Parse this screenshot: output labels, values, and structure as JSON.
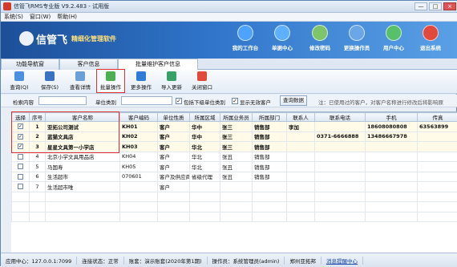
{
  "window": {
    "title": "信管飞RMS专业版 V9.2.483 - 试用版",
    "buttons": [
      "—",
      "□",
      "×"
    ]
  },
  "menubar": [
    "系统(S)",
    "窗口(W)",
    "帮助(H)"
  ],
  "banner": {
    "logo": "信管飞",
    "tagline": "精细化管理软件",
    "buttons": [
      {
        "label": "我的工作台",
        "icon": "monitor-icon"
      },
      {
        "label": "单据中心",
        "icon": "documents-icon"
      },
      {
        "label": "修改密码",
        "icon": "users-icon"
      },
      {
        "label": "更换操作员",
        "icon": "user-swap-icon"
      },
      {
        "label": "用户中心",
        "icon": "user-center-icon"
      },
      {
        "label": "退出系统",
        "icon": "power-icon"
      }
    ]
  },
  "tabs": [
    "功能导航窗",
    "客户信息",
    "批量维护客户信息"
  ],
  "toolbar": [
    {
      "label": "查询(Q)"
    },
    {
      "label": "保存(S)"
    },
    {
      "label": "查看详情"
    },
    {
      "label": "批量操作"
    },
    {
      "label": "更多操作"
    },
    {
      "label": "导入更新"
    },
    {
      "label": "关闭窗口"
    }
  ],
  "search": {
    "content_label": "检索内容",
    "category_label": "单位类别",
    "include_sub_label": "包括下级单位类别",
    "show_invalid_label": "显示无效客户",
    "query_button": "查询数据",
    "hint": "注：已使用过的客户，对客户名称进行修改后将影响原"
  },
  "grid": {
    "columns": [
      "选择",
      "序号",
      "客户名称",
      "客户编码",
      "单位性质",
      "所属区域",
      "所属业务员",
      "所属部门",
      "联系人",
      "联系电话",
      "手机",
      "传真"
    ],
    "rows": [
      {
        "checked": true,
        "no": "1",
        "name": "亚拓公司测试",
        "code": "KH01",
        "nature": "客户",
        "region": "华中",
        "salesman": "张三",
        "dept": "销售部",
        "contact": "李加",
        "phone": "",
        "mobile": "18608080808",
        "fax": "63563899"
      },
      {
        "checked": true,
        "no": "2",
        "name": "蓝猫文具店",
        "code": "KH02",
        "nature": "客户",
        "region": "华中",
        "salesman": "张三",
        "dept": "销售部",
        "contact": "",
        "phone": "0371-6666888",
        "mobile": "13486667978",
        "fax": ""
      },
      {
        "checked": true,
        "no": "3",
        "name": "星星文具第一小学店",
        "code": "KH03",
        "nature": "客户",
        "region": "华北",
        "salesman": "张三",
        "dept": "销售部",
        "contact": "",
        "phone": "",
        "mobile": "",
        "fax": ""
      },
      {
        "checked": false,
        "no": "4",
        "name": "北京小学文具用品店",
        "code": "KH04",
        "nature": "客户",
        "region": "华北",
        "salesman": "张丑",
        "dept": "销售部",
        "contact": "",
        "phone": "",
        "mobile": "",
        "fax": ""
      },
      {
        "checked": false,
        "no": "5",
        "name": "马国寿",
        "code": "KH05",
        "nature": "客户",
        "region": "华北",
        "salesman": "张丑",
        "dept": "销售部",
        "contact": "",
        "phone": "",
        "mobile": "",
        "fax": ""
      },
      {
        "checked": false,
        "no": "6",
        "name": "生活超市",
        "code": "070601",
        "nature": "客户及供应商",
        "region": "省级代理",
        "salesman": "张丑",
        "dept": "销售部",
        "contact": "",
        "phone": "",
        "mobile": "",
        "fax": ""
      },
      {
        "checked": false,
        "no": "7",
        "name": "生活超市唯",
        "code": "",
        "nature": "客户",
        "region": "",
        "salesman": "",
        "dept": "",
        "contact": "",
        "phone": "",
        "mobile": "",
        "fax": ""
      }
    ]
  },
  "statusbar": {
    "app_center": "应用中心：127.0.0.1:7099",
    "connection": "连接状态：正常",
    "account": "账套：演示账套(2020年第1期)",
    "operator": "操作员：系统管理员(admin)",
    "branch": "郑州亚拓邦",
    "message": "消息提醒中心"
  }
}
